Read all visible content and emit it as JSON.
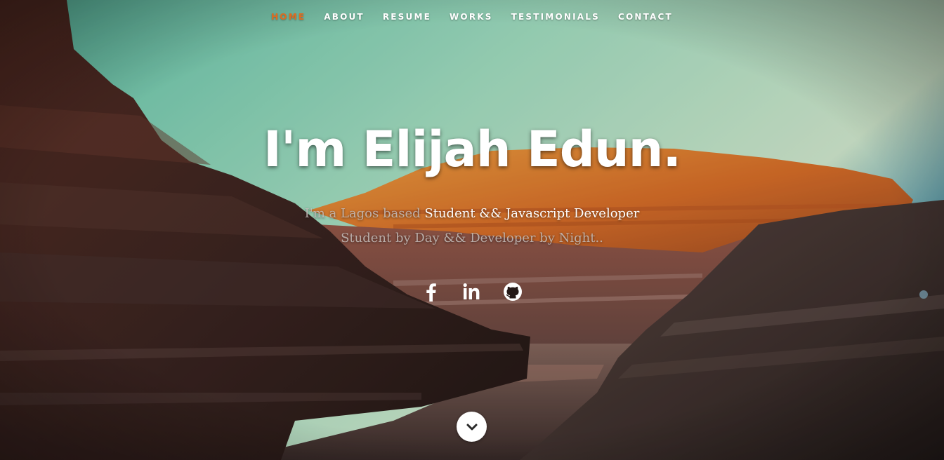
{
  "nav": {
    "items": [
      {
        "label": "HOME",
        "active": true
      },
      {
        "label": "ABOUT",
        "active": false
      },
      {
        "label": "RESUME",
        "active": false
      },
      {
        "label": "WORKS",
        "active": false
      },
      {
        "label": "TESTIMONIALS",
        "active": false
      },
      {
        "label": "CONTACT",
        "active": false
      }
    ],
    "active_color": "#e06b1f"
  },
  "banner": {
    "title": "I'm Elijah Edun.",
    "line1_prefix": "I'm a Lagos based",
    "line1_highlight": "Student && Javascript Developer",
    "line2": "Student by Day && Developer by Night.."
  },
  "social": [
    {
      "icon": "facebook-icon"
    },
    {
      "icon": "linkedin-icon"
    },
    {
      "icon": "github-icon"
    }
  ],
  "scroll_button": {
    "icon": "chevron-down-icon"
  }
}
